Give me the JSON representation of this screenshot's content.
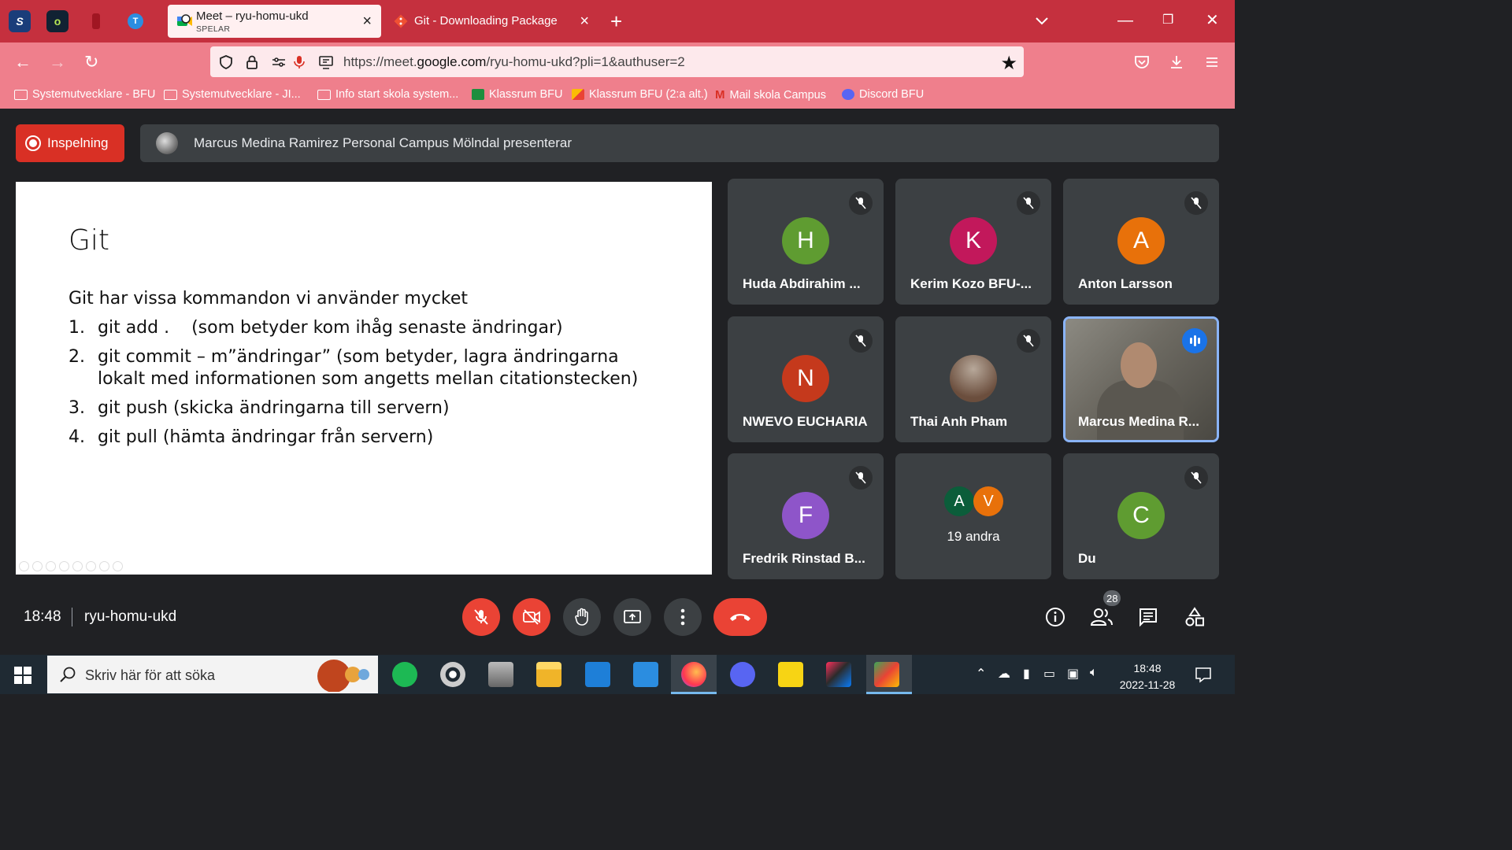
{
  "browser": {
    "tabs": [
      {
        "title": "Meet – ryu-homu-ukd",
        "subtitle": "SPELAR",
        "active": true
      },
      {
        "title": "Git - Downloading Package",
        "active": false
      }
    ],
    "url_prefix": "https://meet.",
    "url_domain": "google.com",
    "url_suffix": "/ryu-homu-ukd?pli=1&authuser=2",
    "bookmarks": [
      {
        "label": "Systemutvecklare - BFU",
        "icon": "folder-icon"
      },
      {
        "label": "Systemutvecklare - JI...",
        "icon": "folder-icon"
      },
      {
        "label": "Info start skola system...",
        "icon": "folder-icon"
      },
      {
        "label": "Klassrum BFU",
        "icon": "classroom-icon"
      },
      {
        "label": "Klassrum BFU (2:a alt.)",
        "icon": "classroom-icon"
      },
      {
        "label": "Mail skola Campus",
        "icon": "gmail-icon"
      },
      {
        "label": "Discord BFU",
        "icon": "discord-icon"
      }
    ],
    "colors": {
      "tabbar": "#c5303e",
      "toolbar": "#ef7f8c"
    }
  },
  "meet": {
    "recording_label": "Inspelning",
    "presenter_text": "Marcus Medina Ramirez Personal Campus Mölndal presenterar",
    "slide": {
      "title": "Git",
      "intro": "Git har vissa kommandon vi använder mycket",
      "items": [
        {
          "num": "1.",
          "text": "git add .    (som betyder kom ihåg senaste ändringar)"
        },
        {
          "num": "2.",
          "text": "git commit – m”ändringar” (som betyder, lagra ändringarna lokalt med informationen som angetts mellan citationstecken)"
        },
        {
          "num": "3.",
          "text": "git push (skicka ändringarna till servern)"
        },
        {
          "num": "4.",
          "text": "git pull  (hämta ändringar från servern)"
        }
      ]
    },
    "participants": [
      {
        "name": "Huda Abdirahim ...",
        "initial": "H",
        "color": "#5f9c31",
        "muted": true
      },
      {
        "name": "Kerim Kozo BFU-...",
        "initial": "K",
        "color": "#c2185b",
        "muted": true
      },
      {
        "name": "Anton Larsson",
        "initial": "A",
        "color": "#e8710a",
        "muted": true
      },
      {
        "name": "NWEVO EUCHARIA",
        "initial": "N",
        "color": "#c5391c",
        "muted": true
      },
      {
        "name": "Thai Anh Pham",
        "initial": "",
        "color": "#7a6a60",
        "muted": true
      },
      {
        "name": "Marcus Medina R...",
        "initial": "",
        "color": "",
        "muted": false,
        "speaking": true
      },
      {
        "name": "Fredrik Rinstad B...",
        "initial": "F",
        "color": "#8e55c9",
        "muted": true
      },
      {
        "name": "Du",
        "initial": "C",
        "color": "#5f9c31",
        "muted": true
      }
    ],
    "others": {
      "label": "19 andra",
      "avatars": [
        {
          "initial": "A",
          "color": "#0b5d3a"
        },
        {
          "initial": "V",
          "color": "#e8710a"
        }
      ]
    },
    "time": "18:48",
    "meeting_code": "ryu-homu-ukd",
    "people_count": "28"
  },
  "taskbar": {
    "search_placeholder": "Skriv här för att söka",
    "time": "18:48",
    "date": "2022-11-28"
  }
}
